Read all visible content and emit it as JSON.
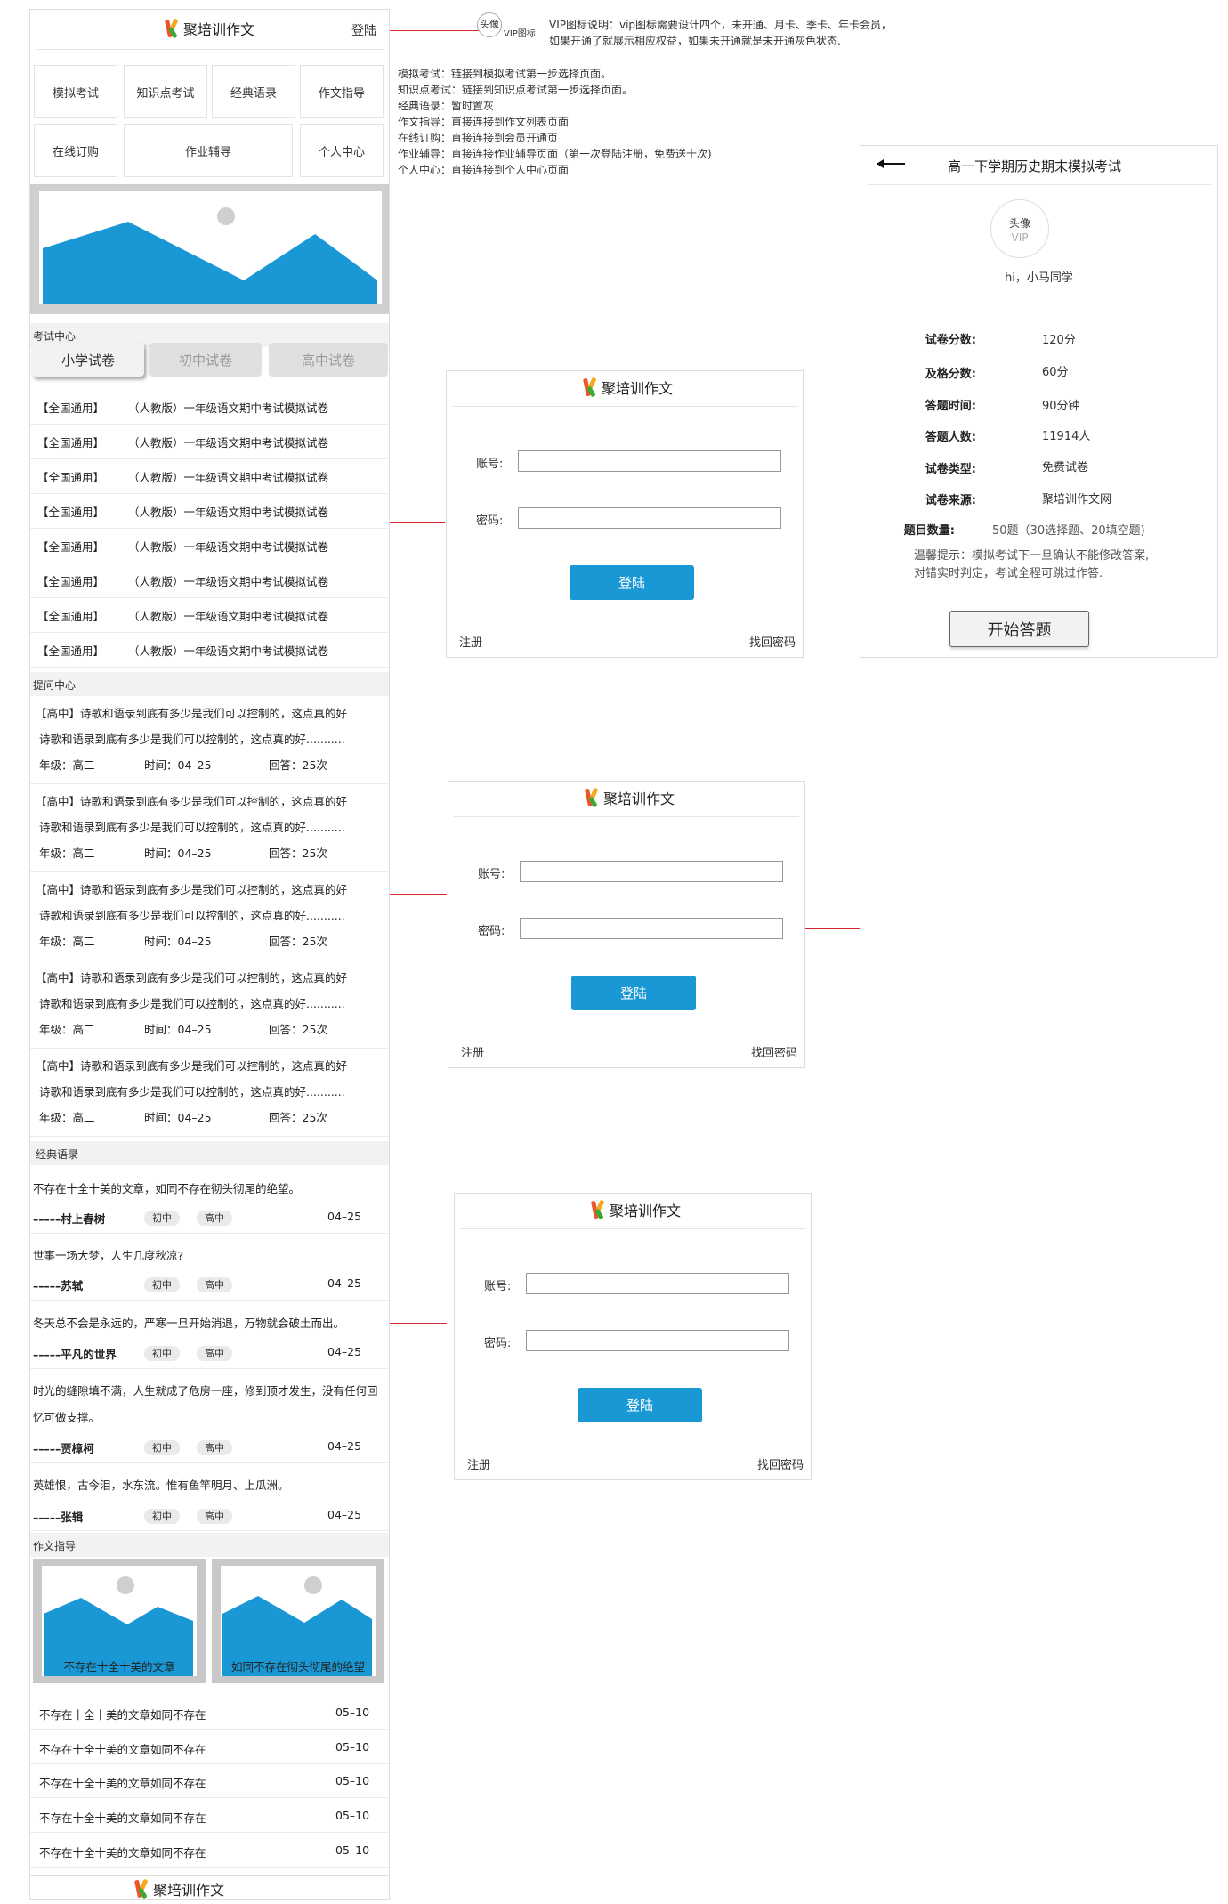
{
  "brand": "聚培训作文",
  "header": {
    "login": "登陆"
  },
  "nav": [
    "模拟考试",
    "知识点考试",
    "经典语录",
    "作文指导",
    "在线订购",
    "作业辅导",
    "个人中心"
  ],
  "exam_center": {
    "title": "考试中心",
    "tabs": [
      "小学试卷",
      "初中试卷",
      "高中试卷"
    ],
    "active_tab": "小学试卷",
    "rows": [
      {
        "tag": "【全国通用】",
        "title": "（人教版）一年级语文期中考试模拟试卷"
      },
      {
        "tag": "【全国通用】",
        "title": "（人教版）一年级语文期中考试模拟试卷"
      },
      {
        "tag": "【全国通用】",
        "title": "（人教版）一年级语文期中考试模拟试卷"
      },
      {
        "tag": "【全国通用】",
        "title": "（人教版）一年级语文期中考试模拟试卷"
      },
      {
        "tag": "【全国通用】",
        "title": "（人教版）一年级语文期中考试模拟试卷"
      },
      {
        "tag": "【全国通用】",
        "title": "（人教版）一年级语文期中考试模拟试卷"
      },
      {
        "tag": "【全国通用】",
        "title": "（人教版）一年级语文期中考试模拟试卷"
      },
      {
        "tag": "【全国通用】",
        "title": "（人教版）一年级语文期中考试模拟试卷"
      }
    ]
  },
  "qa_center": {
    "title": "提问中心",
    "items": [
      {
        "level": "【高中】",
        "line1": "诗歌和语录到底有多少是我们可以控制的，这点真的好",
        "line2": "诗歌和语录到底有多少是我们可以控制的，这点真的好...........",
        "grade": "年级：高二",
        "time": "时间：04–25",
        "answers": "回答：25次"
      },
      {
        "level": "【高中】",
        "line1": "诗歌和语录到底有多少是我们可以控制的，这点真的好",
        "line2": "诗歌和语录到底有多少是我们可以控制的，这点真的好...........",
        "grade": "年级：高二",
        "time": "时间：04–25",
        "answers": "回答：25次"
      },
      {
        "level": "【高中】",
        "line1": "诗歌和语录到底有多少是我们可以控制的，这点真的好",
        "line2": "诗歌和语录到底有多少是我们可以控制的，这点真的好...........",
        "grade": "年级：高二",
        "time": "时间：04–25",
        "answers": "回答：25次"
      },
      {
        "level": "【高中】",
        "line1": "诗歌和语录到底有多少是我们可以控制的，这点真的好",
        "line2": "诗歌和语录到底有多少是我们可以控制的，这点真的好...........",
        "grade": "年级：高二",
        "time": "时间：04–25",
        "answers": "回答：25次"
      },
      {
        "level": "【高中】",
        "line1": "诗歌和语录到底有多少是我们可以控制的，这点真的好",
        "line2": "诗歌和语录到底有多少是我们可以控制的，这点真的好...........",
        "grade": "年级：高二",
        "time": "时间：04–25",
        "answers": "回答：25次"
      }
    ]
  },
  "quotes": {
    "title": "经典语录",
    "items": [
      {
        "text": "不存在十全十美的文章，如同不存在彻头彻尾的绝望。",
        "author": "–––––村上春树",
        "tags": [
          "初中",
          "高中"
        ],
        "date": "04–25"
      },
      {
        "text": "世事一场大梦，人生几度秋凉?",
        "author": "–––––苏轼",
        "tags": [
          "初中",
          "高中"
        ],
        "date": "04–25"
      },
      {
        "text": "冬天总不会是永远的，严寒一旦开始消退，万物就会破土而出。",
        "author": "–––––平凡的世界",
        "tags": [
          "初中",
          "高中"
        ],
        "date": "04–25"
      },
      {
        "text": "时光的缝隙填不满，人生就成了危房一座，修到顶才发生，没有任何回忆可做支撑。",
        "author": "–––––贾樟柯",
        "tags": [
          "初中",
          "高中"
        ],
        "date": "04–25"
      },
      {
        "text": "英雄恨，古今泪，水东流。惟有鱼竿明月、上瓜洲。",
        "author": "–––––张辑",
        "tags": [
          "初中",
          "高中"
        ],
        "date": "04–25"
      }
    ]
  },
  "guide": {
    "title": "作文指导",
    "image_captions": [
      "不存在十全十美的文章",
      "如同不存在彻头彻尾的绝望"
    ],
    "rows": [
      {
        "title": "不存在十全十美的文章如同不存在",
        "date": "05–10"
      },
      {
        "title": "不存在十全十美的文章如同不存在",
        "date": "05–10"
      },
      {
        "title": "不存在十全十美的文章如同不存在",
        "date": "05–10"
      },
      {
        "title": "不存在十全十美的文章如同不存在",
        "date": "05–10"
      },
      {
        "title": "不存在十全十美的文章如同不存在",
        "date": "05–10"
      }
    ]
  },
  "annotations": {
    "avatar": "头像",
    "vip_icon": "VIP图标",
    "vip_note_1": "VIP图标说明：vip图标需要设计四个，未开通、月卡、季卡、年卡会员，",
    "vip_note_2": "如果开通了就展示相应权益，如果未开通就是未开通灰色状态.",
    "nav_notes": [
      "模拟考试：链接到模拟考试第一步选择页面。",
      "知识点考试：链接到知识点考试第一步选择页面。",
      "经典语录：暂时置灰",
      "作文指导：直接连接到作文列表页面",
      "在线订购：直接连接到会员开通页",
      "作业辅导：直接连接作业辅导页面（第一次登陆注册，免费送十次)",
      "个人中心：直接连接到个人中心页面"
    ]
  },
  "login_dialog": {
    "account_label": "账号:",
    "password_label": "密码:",
    "submit": "登陆",
    "register": "注册",
    "forgot": "找回密码"
  },
  "exam_detail": {
    "title": "高一下学期历史期末模拟考试",
    "avatar": "头像",
    "vip": "VIP",
    "greeting": "hi，小马同学",
    "fields": [
      {
        "k": "试卷分数:",
        "v": "120分"
      },
      {
        "k": "及格分数:",
        "v": "60分"
      },
      {
        "k": "答题时间:",
        "v": "90分钟"
      },
      {
        "k": "答题人数:",
        "v": "11914人"
      },
      {
        "k": "试卷类型:",
        "v": "免费试卷"
      },
      {
        "k": "试卷来源:",
        "v": "聚培训作文网"
      }
    ],
    "count_label": "题目数量:",
    "count_value": "50题（30选择题、20填空题)",
    "tip1": "温馨提示：模拟考试下一旦确认不能修改答案,",
    "tip2": "对错实时判定，考试全程可跳过作答.",
    "start": "开始答题"
  },
  "colors": {
    "accent": "#1a98d5",
    "connector": "#d8282f",
    "placeholder_grey": "#cfcfcf"
  }
}
